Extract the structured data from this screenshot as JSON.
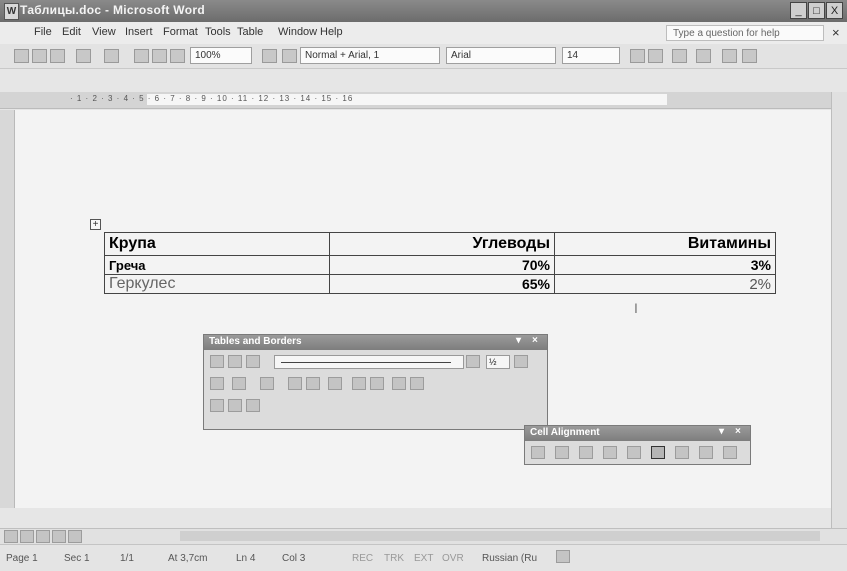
{
  "window": {
    "title": "Таблицы.doc - Microsoft Word",
    "min_label": "_",
    "max_label": "□",
    "close_label": "X"
  },
  "menu": {
    "items": [
      "File",
      "Edit",
      "View",
      "Insert",
      "Format",
      "Tools",
      "Table",
      "Window",
      "Help"
    ],
    "help_placeholder": "Type a question for help",
    "close_label": "×"
  },
  "toolbar": {
    "zoom": "100%",
    "style": "Normal + Arial, 1",
    "font": "Arial",
    "size": "14"
  },
  "ruler": {
    "numbers": "· 1 · 2 · 3 · 4 · 5 · 6 · 7 · 8 · 9 · 10 · 11 · 12 · 13 · 14 · 15 · 16"
  },
  "table": {
    "header": [
      "Крупа",
      "Углеводы",
      "Витамины"
    ],
    "rows": [
      [
        "Греча",
        "70%",
        "3%"
      ],
      [
        "Геркулес",
        "65%",
        "2%"
      ]
    ]
  },
  "tables_borders": {
    "title": "Tables and Borders",
    "weight": "½"
  },
  "cell_alignment": {
    "title": "Cell Alignment"
  },
  "status": {
    "page": "Page 1",
    "sec": "Sec 1",
    "pages": "1/1",
    "at": "At 3,7cm",
    "ln": "Ln 4",
    "col": "Col 3",
    "rec": "REC",
    "trk": "TRK",
    "ext": "EXT",
    "ovr": "OVR",
    "lang": "Russian (Ru"
  }
}
